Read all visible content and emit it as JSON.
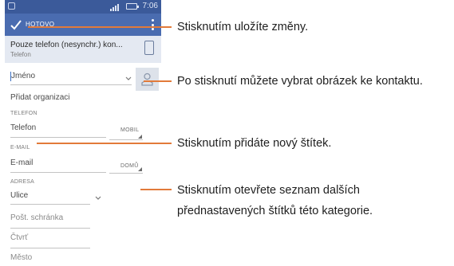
{
  "status_bar": {
    "time": "7:06"
  },
  "action_bar": {
    "done_label": "HOTOVO"
  },
  "account": {
    "title": "Pouze telefon (nesynchr.) kon...",
    "subtitle": "Telefon"
  },
  "form": {
    "name_placeholder": "Jméno",
    "add_organization": "Přidat organizaci",
    "phone_section": "TELEFON",
    "phone_placeholder": "Telefon",
    "phone_type": "MOBIL",
    "email_section": "E-MAIL",
    "email_placeholder": "E-mail",
    "email_type": "DOMŮ",
    "address_section": "ADRESA",
    "street_placeholder": "Ulice",
    "po_box_placeholder": "Pošt. schránka",
    "neighborhood_placeholder": "Čtvrť",
    "city_placeholder": "Město"
  },
  "callouts": {
    "save": "Stisknutím uložíte změny.",
    "photo": "Po stisknutí můžete vybrat obrázek ke kontaktu.",
    "label": "Stisknutím přidáte nový štítek.",
    "expand_line1": "Stisknutím otevřete seznam dalších",
    "expand_line2": "přednastavených štítků této kategorie."
  },
  "colors": {
    "status_bar": "#3b5a9a",
    "action_bar": "#4a6cb0",
    "account_bg": "#e4e9f2",
    "callout_line": "#e27a3a"
  },
  "icons": [
    "check-icon",
    "overflow-menu-icon",
    "phone-device-icon",
    "contact-photo-icon",
    "chevron-down-icon"
  ]
}
